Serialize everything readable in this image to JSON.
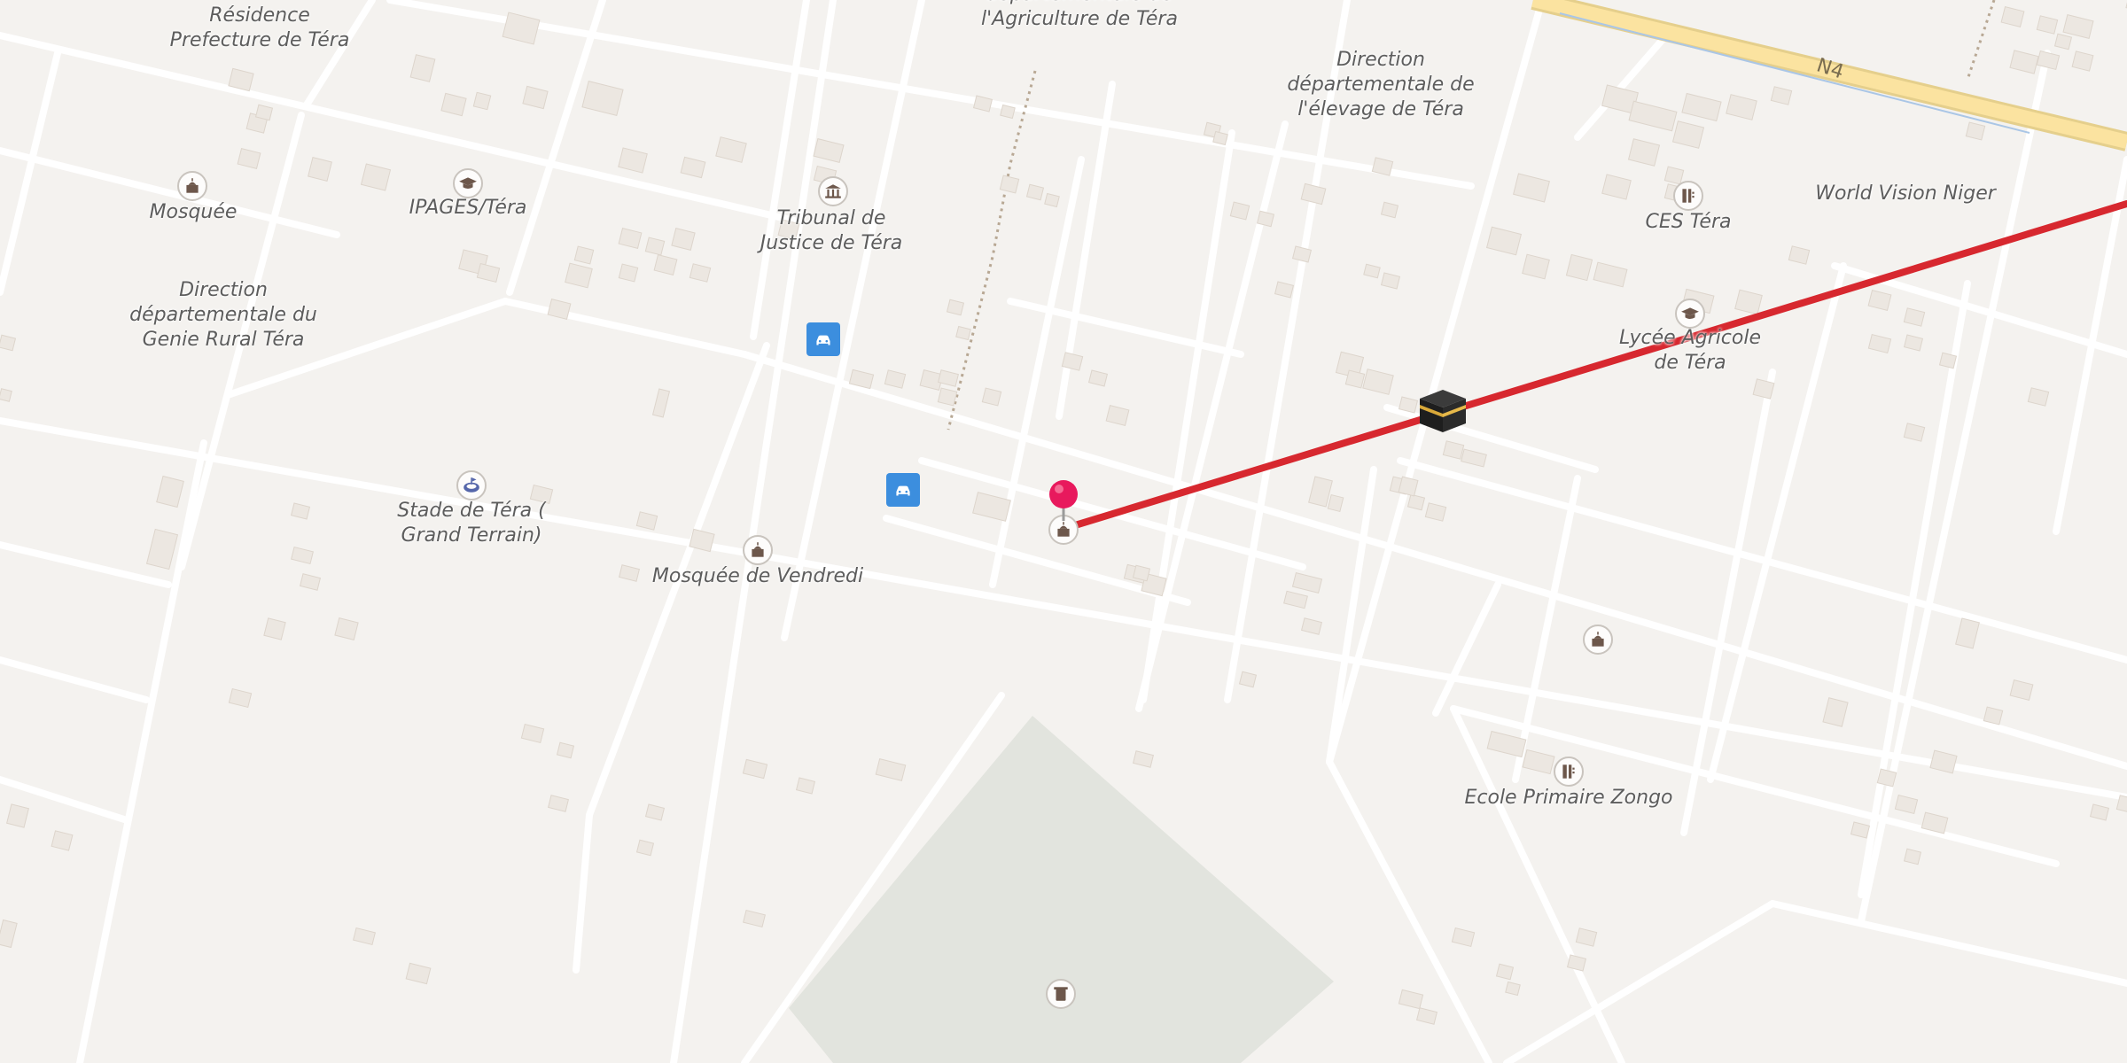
{
  "map": {
    "road_label": "N4",
    "route_color": "#d7282f",
    "pin_color": "#e8195d",
    "labels": [
      {
        "id": "residence",
        "text": "Résidence\nPrefecture de Téra"
      },
      {
        "id": "agriculture",
        "text": "départementale de\nl'Agriculture de Téra"
      },
      {
        "id": "elevage",
        "text": "Direction\ndépartementale de\nl'élevage de Téra"
      },
      {
        "id": "mosquee1",
        "text": "Mosquée"
      },
      {
        "id": "ipages",
        "text": "IPAGES/Téra"
      },
      {
        "id": "tribunal",
        "text": "Tribunal de\nJustice de Téra"
      },
      {
        "id": "ces",
        "text": "CES Téra"
      },
      {
        "id": "worldvision",
        "text": "World Vision Niger"
      },
      {
        "id": "genie",
        "text": "Direction\ndépartementale du\nGenie Rural Téra"
      },
      {
        "id": "lycee",
        "text": "Lycée Agricole\nde Téra"
      },
      {
        "id": "stade",
        "text": "Stade de Téra (\nGrand Terrain)"
      },
      {
        "id": "vendredi",
        "text": "Mosquée de Vendredi"
      },
      {
        "id": "zongo",
        "text": "Ecole Primaire Zongo"
      }
    ],
    "icons": [
      {
        "id": "mosque1",
        "icon": "mosque-icon"
      },
      {
        "id": "ipages",
        "icon": "graduation-cap-icon"
      },
      {
        "id": "tribunal",
        "icon": "courthouse-icon"
      },
      {
        "id": "ces",
        "icon": "school-icon"
      },
      {
        "id": "lycee",
        "icon": "graduation-cap-icon"
      },
      {
        "id": "stade",
        "icon": "stadium-icon"
      },
      {
        "id": "vendredi",
        "icon": "mosque-icon"
      },
      {
        "id": "pin-mosque",
        "icon": "mosque-icon"
      },
      {
        "id": "mosque3",
        "icon": "mosque-icon"
      },
      {
        "id": "zongo",
        "icon": "school-icon"
      },
      {
        "id": "cemetery",
        "icon": "cemetery-icon"
      },
      {
        "id": "parking1",
        "icon": "car-icon"
      },
      {
        "id": "parking2",
        "icon": "car-icon"
      },
      {
        "id": "kaaba",
        "icon": "kaaba-icon"
      },
      {
        "id": "pin",
        "icon": "location-pin-icon"
      }
    ]
  }
}
